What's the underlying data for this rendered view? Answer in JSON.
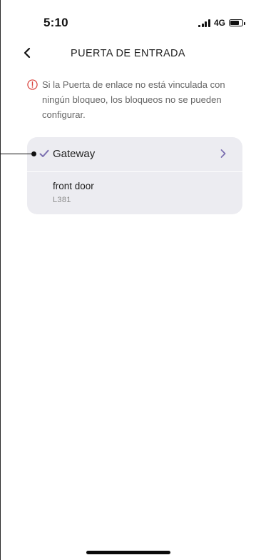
{
  "status_bar": {
    "time": "5:10",
    "network": "4G",
    "battery_level": 0.75
  },
  "nav": {
    "title": "PUERTA DE ENTRADA",
    "back_icon": "chevron-left-icon"
  },
  "warning": {
    "icon": "exclamation-circle-icon",
    "text": "Si la Puerta de enlace no está vinculada con ningún bloqueo, los bloqueos no se pueden configurar."
  },
  "gateway_card": {
    "label": "Gateway",
    "selected": true,
    "check_icon": "check-icon",
    "chevron_icon": "chevron-right-icon",
    "locks": [
      {
        "name": "front door",
        "model": "L381"
      }
    ]
  },
  "colors": {
    "accent": "#7b6fb0",
    "warning": "#d9413b",
    "card_background": "#ececf1",
    "secondary_text": "#666666"
  }
}
